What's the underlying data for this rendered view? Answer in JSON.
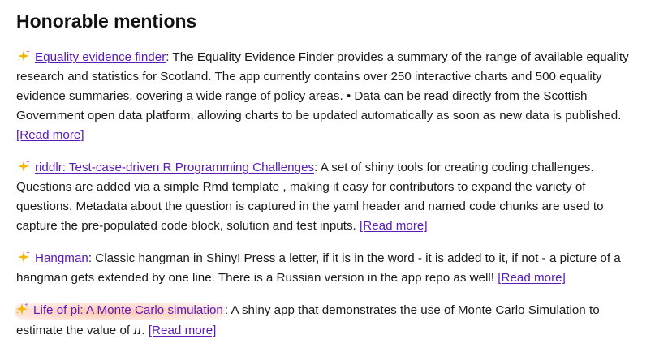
{
  "heading": "Honorable mentions",
  "colors": {
    "link": "#5a1ab8",
    "sparkle_large": "#f2b705",
    "sparkle_small": "#b77be6",
    "highlight": "#ffb091"
  },
  "entries": [
    {
      "icon": "sparkles-icon",
      "link_text": "Equality evidence finder",
      "description": ": The Equality Evidence Finder provides a summary of the range of available equality research and statistics for Scotland. The app currently contains over 250 interactive charts and 500 equality evidence summaries, covering a wide range of policy areas. • Data can be read directly from the Scottish Government open data platform, allowing charts to be updated automatically as soon as new data is published.",
      "read_more": "[Read more]"
    },
    {
      "icon": "sparkles-icon",
      "link_text": "riddlr: Test-case-driven R Programming Challenges",
      "description": ": A set of shiny tools for creating coding challenges. Questions are added via a simple Rmd template , making it easy for contributors to expand the variety of questions. Metadata about the question is captured in the yaml header and named code chunks are used to capture the pre-populated code block, solution and test inputs.",
      "read_more": "[Read more]"
    },
    {
      "icon": "sparkles-icon",
      "link_text": "Hangman",
      "description": ": Classic hangman in Shiny! Press a letter, if it is in the word - it is added to it, if not - a picture of a hangman gets extended by one line. There is a Russian version in the app repo as well!",
      "read_more": "[Read more]"
    },
    {
      "icon": "sparkles-icon",
      "link_text": "Life of pi: A Monte Carlo simulation",
      "description": ": A shiny app that demonstrates the use of Monte Carlo Simulation to estimate the value of ",
      "pi_symbol": "π",
      "description_end": ".",
      "read_more": "[Read more]"
    }
  ]
}
